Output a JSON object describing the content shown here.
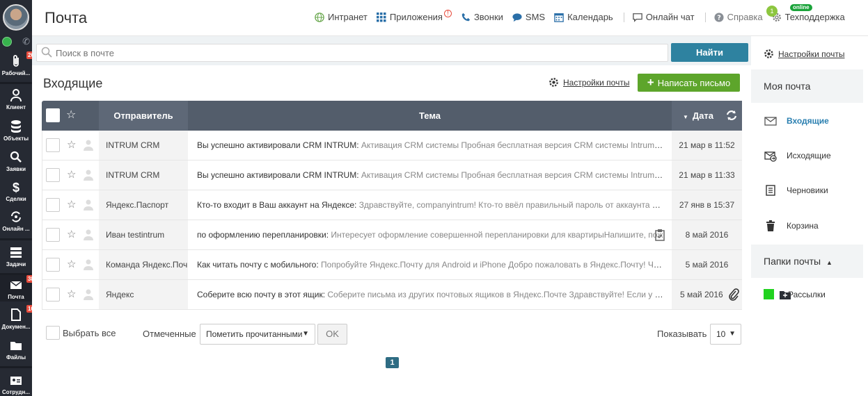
{
  "header": {
    "title": "Почта",
    "nav": {
      "intranet": "Интранет",
      "apps": "Приложения",
      "calls": "Звонки",
      "sms": "SMS",
      "calendar": "Календарь",
      "chat": "Онлайн чат",
      "help": "Справка",
      "support": "Техподдержка"
    },
    "help_badge": "1",
    "online_badge": "online"
  },
  "sidebar": {
    "items": [
      {
        "label": "Рабочий...",
        "badge": "26"
      },
      {
        "label": "Клиент",
        "badge": ""
      },
      {
        "label": "Объекты",
        "badge": ""
      },
      {
        "label": "Заявки",
        "badge": ""
      },
      {
        "label": "Сделки",
        "badge": ""
      },
      {
        "label": "Онлайн ...",
        "badge": ""
      },
      {
        "label": "Задачи",
        "badge": ""
      },
      {
        "label": "Почта",
        "badge": "38"
      },
      {
        "label": "Докумен...",
        "badge": "107"
      },
      {
        "label": "Файлы",
        "badge": ""
      },
      {
        "label": "Сотрудн...",
        "badge": ""
      }
    ]
  },
  "search": {
    "placeholder": "Поиск в почте",
    "button": "Найти"
  },
  "inbox": {
    "title": "Входящие",
    "settings_link": "Настройки почты",
    "compose_button": "Написать письмо",
    "columns": {
      "sender": "Отправитель",
      "subject": "Тема",
      "date": "Дата"
    },
    "rows": [
      {
        "sender": "INTRUM CRM",
        "subject": "Вы успешно активировали CRM INTRUM:",
        "preview": " Активация CRM системы Пробная бесплатная версия CRM системы Intrum Вход",
        "date": "21 мар в 11:52"
      },
      {
        "sender": "INTRUM CRM",
        "subject": "Вы успешно активировали CRM INTRUM:",
        "preview": " Активация CRM системы Пробная бесплатная версия CRM системы Intrum Вход",
        "date": "21 мар в 11:33"
      },
      {
        "sender": "Яндекс.Паспорт",
        "subject": "Кто-то входит в Ваш аккаунт на Яндексе:",
        "preview": " Здравствуйте, companyintrum! Кто-то ввёл правильный пароль от аккаунта compa...",
        "date": "27 янв в 15:37"
      },
      {
        "sender": "Иван testintrum",
        "subject": "по оформлению перепланировки:",
        "preview": " Интересует оформление совершенной  перепланировки для квартирыНапишите, пож",
        "date": "8 май 2016"
      },
      {
        "sender": "Команда Яндекс.Поч",
        "subject": "Как читать почту с мобильного:",
        "preview": " Попробуйте Яндекс.Почту для Android и iPhone Добро пожаловать в Яндекс.Почту! Чтобы ...",
        "date": "5 май 2016"
      },
      {
        "sender": "Яндекс",
        "subject": "Соберите всю почту в этот ящик:",
        "preview": " Соберите письма из других почтовых ящиков в Яндекс.Почте Здравствуйте! Если у Вас уж...",
        "date": "5 май 2016"
      }
    ],
    "footer": {
      "select_all": "Выбрать все",
      "marked_label": "Отмеченные",
      "mark_action": "Пометить прочитанными",
      "ok": "OK",
      "show_label": "Показывать",
      "per_page": "10",
      "page": "1"
    }
  },
  "rightbar": {
    "settings_link": "Настройки почты",
    "my_mail": "Моя почта",
    "folders": [
      {
        "label": "Входящие",
        "icon": "inbox-icon"
      },
      {
        "label": "Исходящие",
        "icon": "outbox-icon"
      },
      {
        "label": "Черновики",
        "icon": "drafts-icon"
      },
      {
        "label": "Корзина",
        "icon": "trash-icon"
      }
    ],
    "mail_folders": "Папки почты",
    "custom_folder": "Рассылки"
  },
  "colors": {
    "accent": "#2e82a0",
    "compose": "#5da52b",
    "sidebar": "#262a33",
    "table_header": "#535d6b"
  }
}
